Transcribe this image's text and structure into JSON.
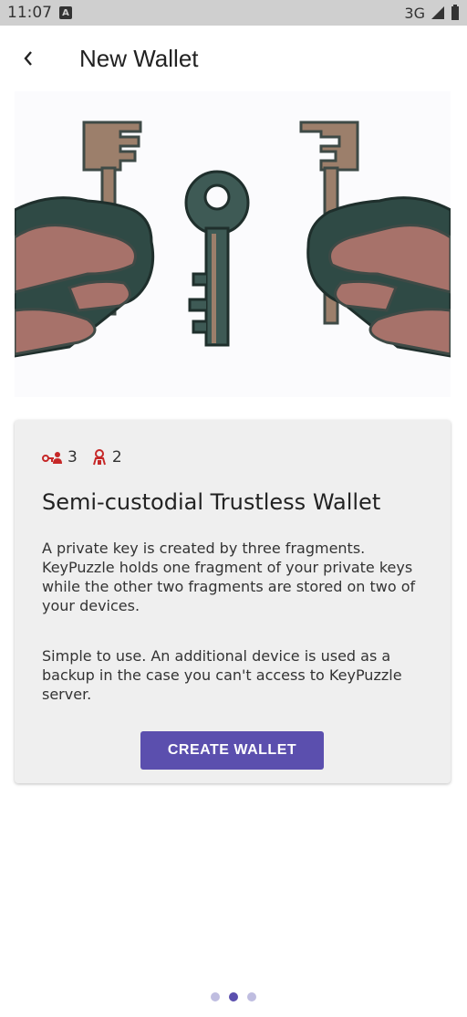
{
  "status_bar": {
    "time": "11:07",
    "badge": "A",
    "network": "3G"
  },
  "header": {
    "title": "New Wallet"
  },
  "card": {
    "stats": [
      {
        "icon": "key-user-icon",
        "value": "3"
      },
      {
        "icon": "person-device-icon",
        "value": "2"
      }
    ],
    "title": "Semi-custodial Trustless Wallet",
    "paragraph1": "A private key is created by three fragments. KeyPuzzle holds one fragment of your private keys while the other two fragments are stored on two of your devices.",
    "paragraph2": "Simple to use. An additional device is used as a backup in the case you can't access to KeyPuzzle server.",
    "button_label": "CREATE WALLET"
  },
  "pager": {
    "pages": 3,
    "active_index": 1
  },
  "colors": {
    "accent": "#5b4fae",
    "stat_icon": "#c62828",
    "hand": "#a7726a",
    "key_dark": "#3e5a55",
    "key_light": "#9c7f6b"
  }
}
